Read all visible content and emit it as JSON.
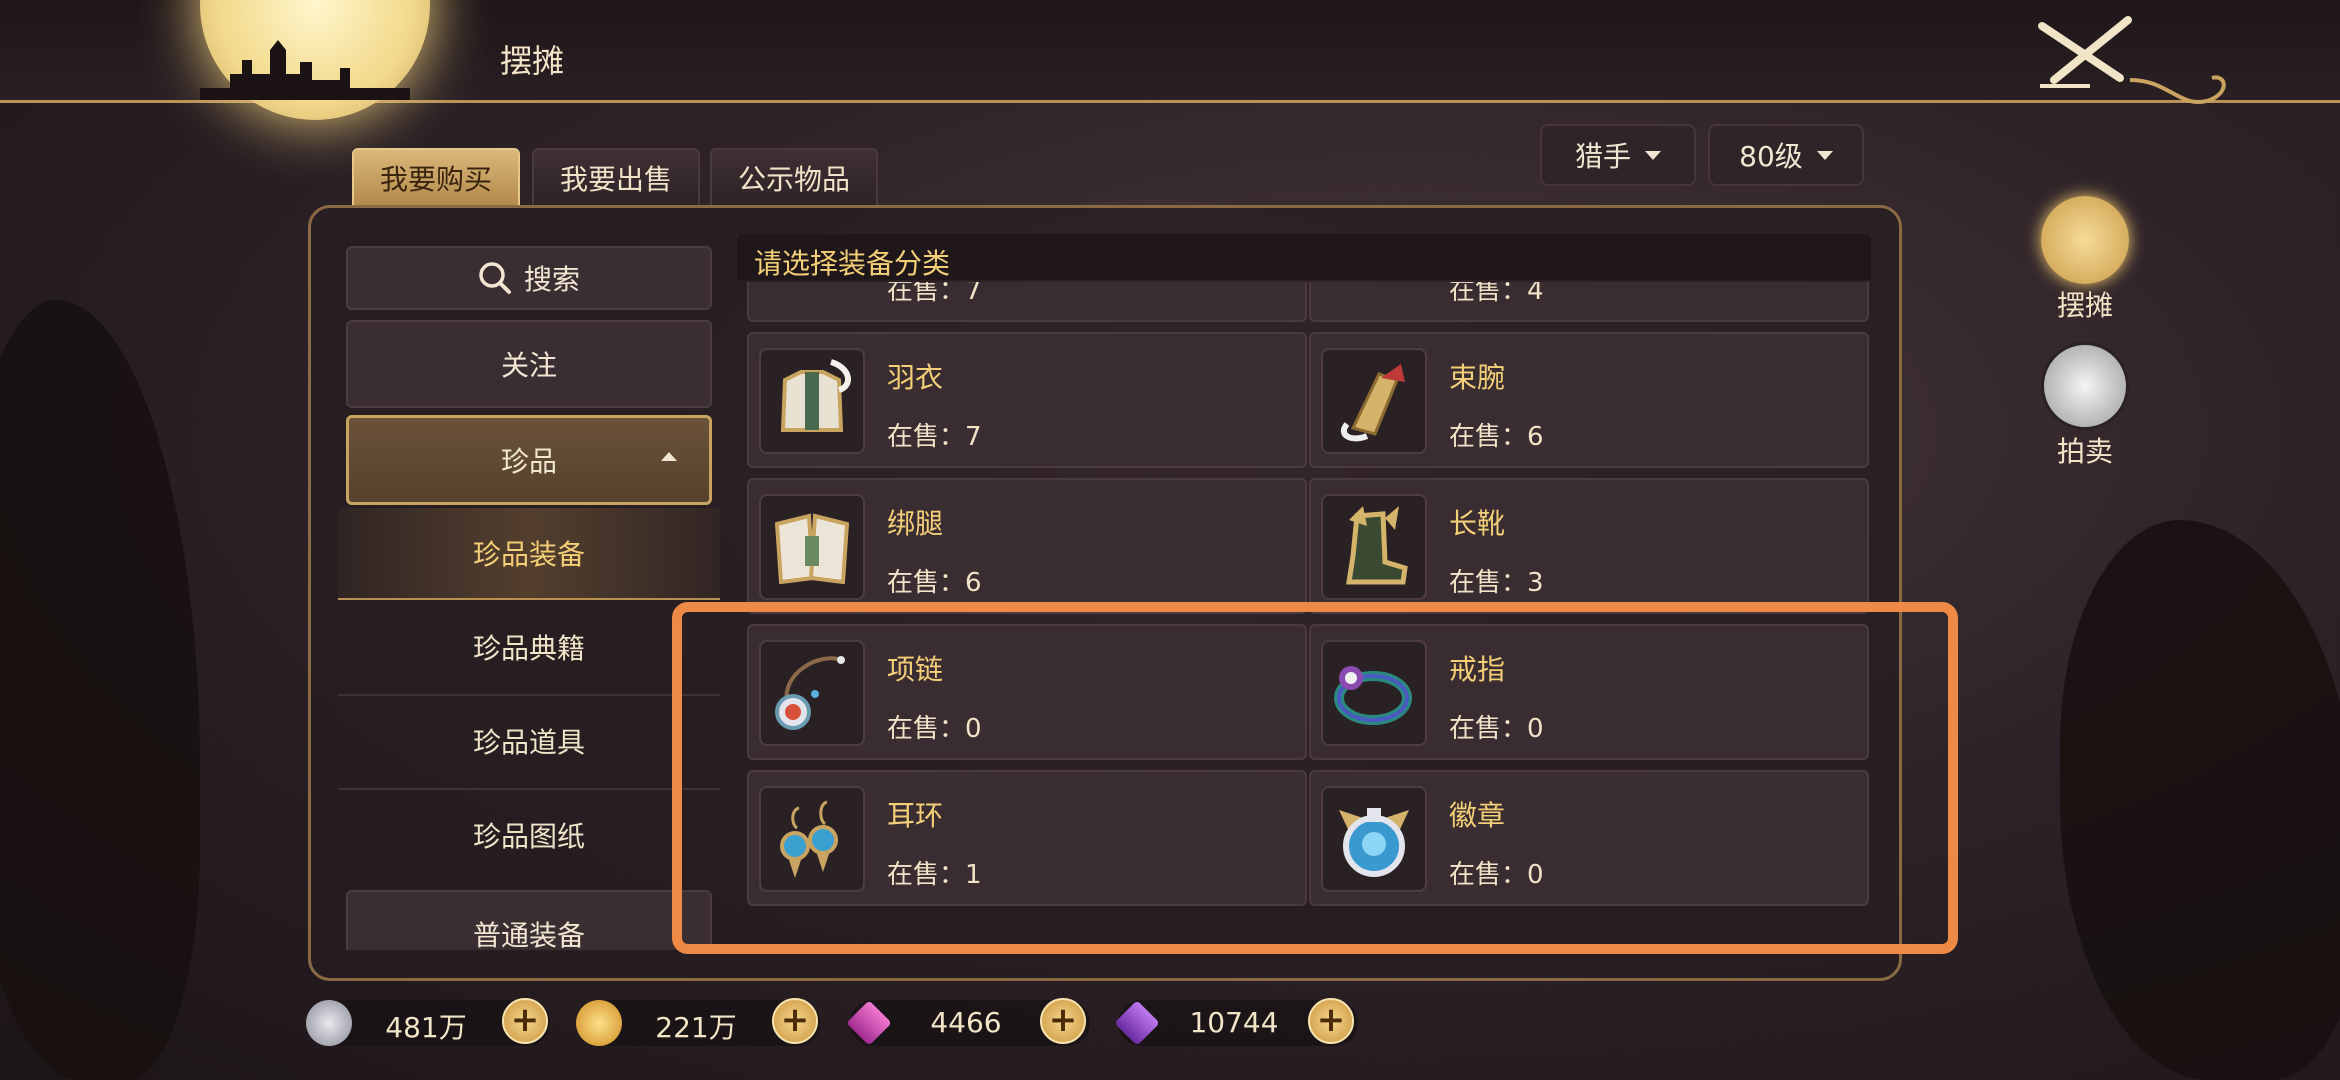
{
  "header": {
    "title": "摆摊"
  },
  "tabs": [
    {
      "label": "我要购买",
      "active": true
    },
    {
      "label": "我要出售",
      "active": false
    },
    {
      "label": "公示物品",
      "active": false
    }
  ],
  "filters": {
    "class": "猎手",
    "level": "80级"
  },
  "sidebar": {
    "search_label": "搜索",
    "items": [
      {
        "label": "关注"
      },
      {
        "label": "珍品",
        "expanded": true
      },
      {
        "label": "珍品装备",
        "selected": true
      },
      {
        "label": "珍品典籍"
      },
      {
        "label": "珍品道具"
      },
      {
        "label": "珍品图纸"
      },
      {
        "label": "普通装备"
      }
    ]
  },
  "grid": {
    "title": "请选择装备分类",
    "partial_top": [
      {
        "count_text": "在售：7"
      },
      {
        "count_text": "在售：4"
      }
    ],
    "items": [
      {
        "name": "羽衣",
        "count_text": "在售：7",
        "icon": "feather-robe-icon"
      },
      {
        "name": "束腕",
        "count_text": "在售：6",
        "icon": "bracer-icon"
      },
      {
        "name": "绑腿",
        "count_text": "在售：6",
        "icon": "leg-guard-icon"
      },
      {
        "name": "长靴",
        "count_text": "在售：3",
        "icon": "boots-icon"
      },
      {
        "name": "项链",
        "count_text": "在售：0",
        "icon": "necklace-icon"
      },
      {
        "name": "戒指",
        "count_text": "在售：0",
        "icon": "ring-icon"
      },
      {
        "name": "耳环",
        "count_text": "在售：1",
        "icon": "earrings-icon"
      },
      {
        "name": "徽章",
        "count_text": "在售：0",
        "icon": "badge-icon"
      }
    ]
  },
  "side_nav": [
    {
      "label": "摆摊",
      "icon": "stall-icon",
      "active": true
    },
    {
      "label": "拍卖",
      "icon": "auction-icon",
      "active": false
    }
  ],
  "currencies": [
    {
      "value": "481万",
      "icon": "silver-coin-icon"
    },
    {
      "value": "221万",
      "icon": "gold-coin-icon"
    },
    {
      "value": "4466",
      "icon": "pink-gem-icon"
    },
    {
      "value": "10744",
      "icon": "purple-gem-icon"
    }
  ],
  "colors": {
    "accent_gold": "#f3cf78",
    "highlight_orange": "#ee8a45",
    "panel_border": "#8a6a44"
  }
}
